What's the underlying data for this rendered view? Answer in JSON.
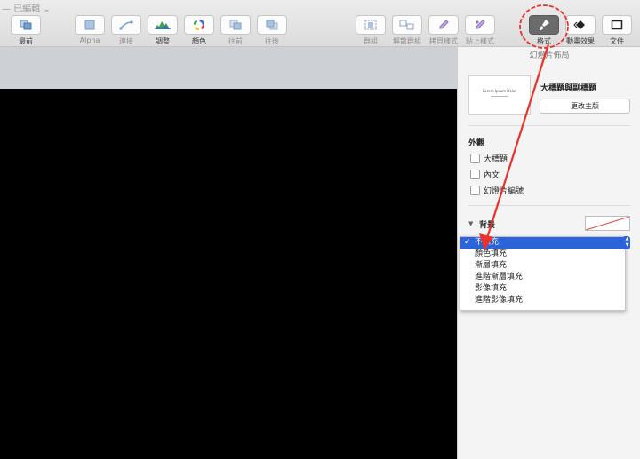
{
  "window": {
    "title": "— 已編輯 ⌄"
  },
  "toolbar": {
    "buttons": [
      {
        "label": "最前",
        "icon": "bring-to-front-icon"
      },
      {
        "label": "Alpha",
        "icon": "alpha-icon"
      },
      {
        "label": "連接",
        "icon": "connection-line-icon"
      },
      {
        "label": "調整",
        "icon": "histogram-icon"
      },
      {
        "label": "顏色",
        "icon": "color-wheel-icon"
      },
      {
        "label": "往前",
        "icon": "bring-forward-icon"
      },
      {
        "label": "往後",
        "icon": "send-backward-icon"
      },
      {
        "label": "群組",
        "icon": "group-icon"
      },
      {
        "label": "解散群組",
        "icon": "ungroup-icon"
      },
      {
        "label": "拷貝樣式",
        "icon": "copy-style-icon"
      },
      {
        "label": "貼上樣式",
        "icon": "paste-style-icon"
      },
      {
        "label": "格式",
        "icon": "paintbrush-icon"
      },
      {
        "label": "動畫效果",
        "icon": "animate-icon"
      },
      {
        "label": "文件",
        "icon": "document-icon"
      }
    ]
  },
  "panel": {
    "title": "幻燈片佈局",
    "thumbnail_text": "Lorem Ipsum Dolor",
    "layout_name": "大標題與副標題",
    "change_master_label": "更改主版",
    "appearance": {
      "heading": "外觀",
      "options": [
        {
          "label": "大標題",
          "checked": false
        },
        {
          "label": "內文",
          "checked": false
        },
        {
          "label": "幻燈片編號",
          "checked": false
        }
      ]
    },
    "background": {
      "heading": "背景"
    }
  },
  "fill_menu": {
    "items": [
      {
        "label": "不填充",
        "selected": true
      },
      {
        "label": "顏色填充",
        "selected": false
      },
      {
        "label": "漸層填充",
        "selected": false
      },
      {
        "label": "進階漸層填充",
        "selected": false
      },
      {
        "label": "影像填充",
        "selected": false
      },
      {
        "label": "進階影像填充",
        "selected": false
      }
    ]
  },
  "colors": {
    "annotation": "#e8322a",
    "selection": "#2b63d9"
  }
}
